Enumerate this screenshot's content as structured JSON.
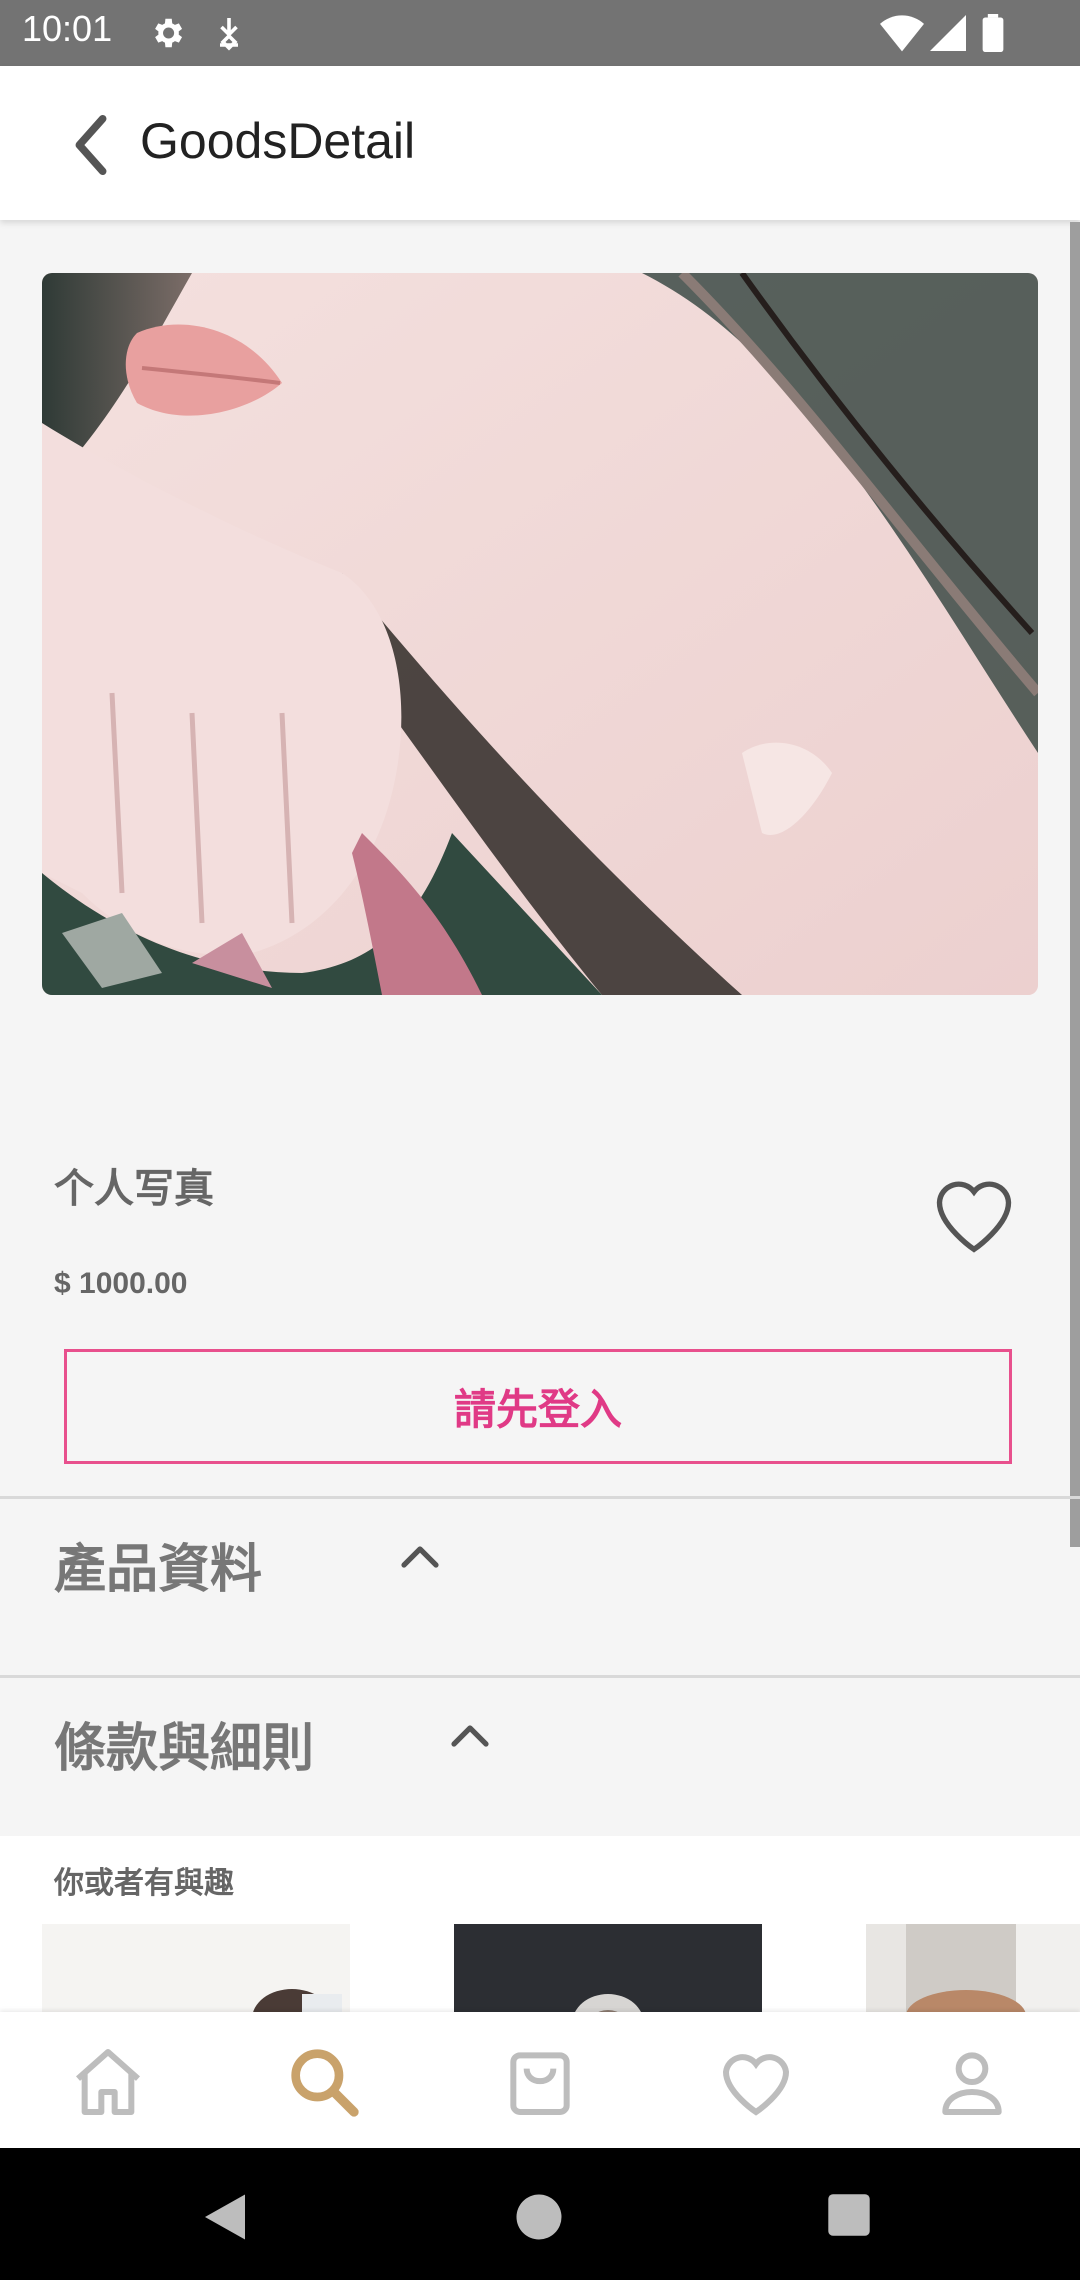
{
  "status_bar": {
    "time": "10:01"
  },
  "app_bar": {
    "title": "GoodsDetail"
  },
  "product": {
    "name": "个人写真",
    "price": "$ 1000.00",
    "login_button": "請先登入"
  },
  "sections": [
    {
      "title": "產品資料"
    },
    {
      "title": "條款與細則"
    }
  ],
  "recommend": {
    "title": "你或者有與趣"
  },
  "bottom_nav": [
    {
      "icon": "home-icon",
      "active": false
    },
    {
      "icon": "search-icon",
      "active": true
    },
    {
      "icon": "cart-icon",
      "active": false
    },
    {
      "icon": "heart-icon",
      "active": false
    },
    {
      "icon": "profile-icon",
      "active": false
    }
  ],
  "colors": {
    "accent": "#e03a86",
    "nav_active": "#c9a26b",
    "nav_inactive": "#bdbdbd"
  }
}
